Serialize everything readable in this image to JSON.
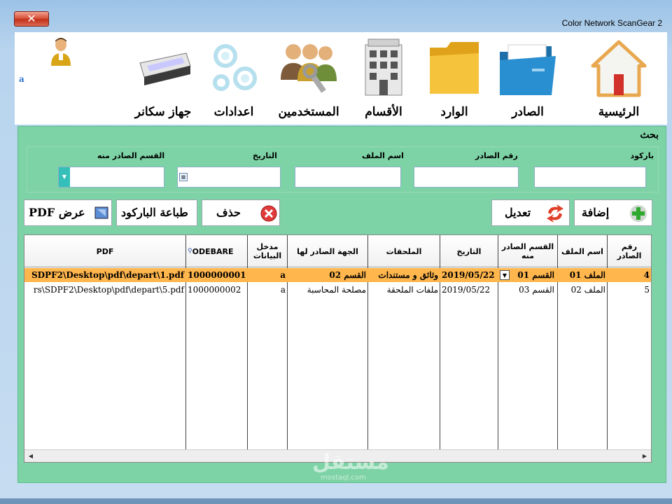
{
  "window": {
    "title": "Color Network ScanGear 2",
    "close_label": "✕"
  },
  "user": {
    "name": "a"
  },
  "toolbar": {
    "items": [
      {
        "label": "الرئيسية",
        "icon": "home-icon"
      },
      {
        "label": "الصادر",
        "icon": "blue-folder-icon"
      },
      {
        "label": "الوارد",
        "icon": "yellow-folder-icon"
      },
      {
        "label": "الأقسام",
        "icon": "building-icon"
      },
      {
        "label": "المستخدمين",
        "icon": "users-keys-icon"
      },
      {
        "label": "اعدادات",
        "icon": "gears-icon"
      },
      {
        "label": "جهاز سكانر",
        "icon": "scanner-icon"
      }
    ]
  },
  "search": {
    "title": "بحث",
    "fields": {
      "barcode": {
        "label": "باركود",
        "value": ""
      },
      "outgoing_number": {
        "label": "رقم الصادر",
        "value": ""
      },
      "file_name": {
        "label": "اسم الملف",
        "value": ""
      },
      "date": {
        "label": "التاريخ",
        "value": ""
      },
      "from_department": {
        "label": "القسم الصادر منه",
        "value": ""
      }
    }
  },
  "actions": {
    "add": "إضافة",
    "edit": "تعديل",
    "delete": "حذف",
    "print_barcode": "طباعة الباركود",
    "view_pdf": "PDF عرض"
  },
  "table": {
    "columns": {
      "number": "رقم الصادر",
      "file_name": "اسم الملف",
      "department": "القسم الصادر منه",
      "date": "التاريخ",
      "attachments": "الملحقات",
      "destination": "الجهة الصادر لها",
      "entered_by": "مدخل البيانات",
      "barcode": "ODEBARE",
      "pdf": "PDF"
    },
    "rows": [
      {
        "number": "4",
        "file_name": "الملف 01",
        "department": "القسم 01",
        "date": "2019/05/22",
        "attachments": "وثائق و مستندات",
        "destination": "القسم 02",
        "entered_by": "a",
        "barcode": "1000000001",
        "pdf": "SDPF2\\Desktop\\pdf\\depart\\1.pdf",
        "selected": true
      },
      {
        "number": "5",
        "file_name": "الملف 02",
        "department": "القسم 03",
        "date": "2019/05/22",
        "attachments": "ملفات الملحقة",
        "destination": "مصلحة المحاسبة",
        "entered_by": "a",
        "barcode": "1000000002",
        "pdf": "rs\\SDPF2\\Desktop\\pdf\\depart\\5.pdf",
        "selected": false
      }
    ]
  },
  "watermark": {
    "text": "مستقل",
    "sub": "mostaql.com"
  },
  "colors": {
    "panel": "#7dd3a5",
    "selected_row": "#ffb64d",
    "accent": "#34c0b8"
  }
}
